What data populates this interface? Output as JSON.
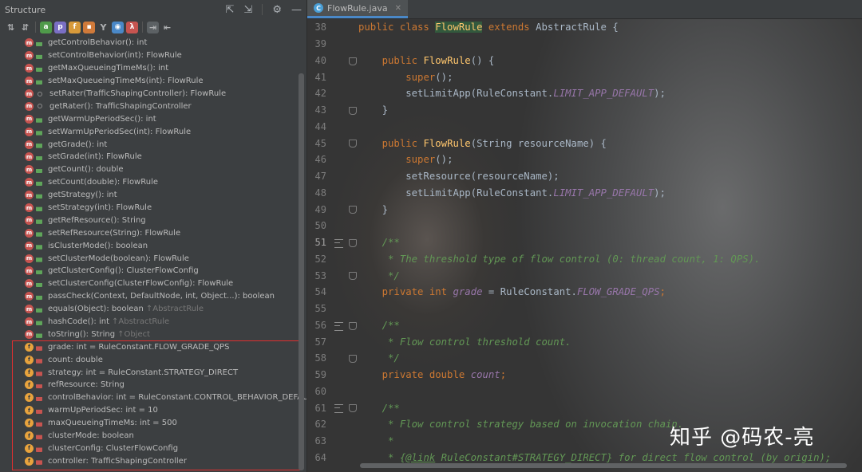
{
  "structure": {
    "title": "Structure",
    "toolbar_icons": [
      "sort-alpha-icon",
      "sort-visibility-icon",
      "show-anonymous-icon",
      "show-properties-icon",
      "show-fields-icon",
      "show-nonpublic-icon",
      "show-inherited-icon",
      "show-lambdas-icon",
      "show-toplevel-icon",
      "autoscroll-to-source-icon",
      "autoscroll-from-source-icon"
    ],
    "items": [
      {
        "kind": "m",
        "vis": "pub",
        "text": "getControlBehavior(): int"
      },
      {
        "kind": "m",
        "vis": "pub",
        "text": "setControlBehavior(int): FlowRule"
      },
      {
        "kind": "m",
        "vis": "pub",
        "text": "getMaxQueueingTimeMs(): int"
      },
      {
        "kind": "m",
        "vis": "pub",
        "text": "setMaxQueueingTimeMs(int): FlowRule"
      },
      {
        "kind": "m",
        "vis": "pkg",
        "text": "setRater(TrafficShapingController): FlowRule"
      },
      {
        "kind": "m",
        "vis": "pkg",
        "text": "getRater(): TrafficShapingController"
      },
      {
        "kind": "m",
        "vis": "pub",
        "text": "getWarmUpPeriodSec(): int"
      },
      {
        "kind": "m",
        "vis": "pub",
        "text": "setWarmUpPeriodSec(int): FlowRule"
      },
      {
        "kind": "m",
        "vis": "pub",
        "text": "getGrade(): int"
      },
      {
        "kind": "m",
        "vis": "pub",
        "text": "setGrade(int): FlowRule"
      },
      {
        "kind": "m",
        "vis": "pub",
        "text": "getCount(): double"
      },
      {
        "kind": "m",
        "vis": "pub",
        "text": "setCount(double): FlowRule"
      },
      {
        "kind": "m",
        "vis": "pub",
        "text": "getStrategy(): int"
      },
      {
        "kind": "m",
        "vis": "pub",
        "text": "setStrategy(int): FlowRule"
      },
      {
        "kind": "m",
        "vis": "pub",
        "text": "getRefResource(): String"
      },
      {
        "kind": "m",
        "vis": "pub",
        "text": "setRefResource(String): FlowRule"
      },
      {
        "kind": "m",
        "vis": "pub",
        "text": "isClusterMode(): boolean"
      },
      {
        "kind": "m",
        "vis": "pub",
        "text": "setClusterMode(boolean): FlowRule"
      },
      {
        "kind": "m",
        "vis": "pub",
        "text": "getClusterConfig(): ClusterFlowConfig"
      },
      {
        "kind": "m",
        "vis": "pub",
        "text": "setClusterConfig(ClusterFlowConfig): FlowRule"
      },
      {
        "kind": "m",
        "vis": "pub",
        "text": "passCheck(Context, DefaultNode, int, Object...): boolean"
      },
      {
        "kind": "m",
        "vis": "pub",
        "text": "equals(Object): boolean",
        "inherited": "↑AbstractRule"
      },
      {
        "kind": "m",
        "vis": "pub",
        "text": "hashCode(): int",
        "inherited": "↑AbstractRule"
      },
      {
        "kind": "m",
        "vis": "pub",
        "text": "toString(): String",
        "inherited": "↑Object"
      },
      {
        "kind": "f",
        "vis": "priv",
        "text": "grade: int = RuleConstant.FLOW_GRADE_QPS"
      },
      {
        "kind": "f",
        "vis": "priv",
        "text": "count: double"
      },
      {
        "kind": "f",
        "vis": "priv",
        "text": "strategy: int = RuleConstant.STRATEGY_DIRECT"
      },
      {
        "kind": "f",
        "vis": "priv",
        "text": "refResource: String"
      },
      {
        "kind": "f",
        "vis": "priv",
        "text": "controlBehavior: int = RuleConstant.CONTROL_BEHAVIOR_DEFAULT"
      },
      {
        "kind": "f",
        "vis": "priv",
        "text": "warmUpPeriodSec: int = 10"
      },
      {
        "kind": "f",
        "vis": "priv",
        "text": "maxQueueingTimeMs: int = 500"
      },
      {
        "kind": "f",
        "vis": "priv",
        "text": "clusterMode: boolean"
      },
      {
        "kind": "f",
        "vis": "priv",
        "text": "clusterConfig: ClusterFlowConfig"
      },
      {
        "kind": "f",
        "vis": "priv",
        "text": "controller: TrafficShapingController"
      }
    ]
  },
  "editor": {
    "tab_label": "FlowRule.java",
    "current_line": "51",
    "lines": [
      {
        "n": "38",
        "fold": false,
        "bm": false,
        "tokens": [
          [
            "kw",
            "public class "
          ],
          [
            "hl",
            "FlowRule"
          ],
          [
            "kw",
            " extends "
          ],
          [
            "txt",
            "AbstractRule {"
          ]
        ]
      },
      {
        "n": "39",
        "tokens": []
      },
      {
        "n": "40",
        "fold": true,
        "tokens": [
          [
            "txt",
            "    "
          ],
          [
            "kw",
            "public "
          ],
          [
            "fn",
            "FlowRule"
          ],
          [
            "txt",
            "() {"
          ]
        ]
      },
      {
        "n": "41",
        "tokens": [
          [
            "txt",
            "        "
          ],
          [
            "kw",
            "super"
          ],
          [
            "txt",
            "();"
          ]
        ]
      },
      {
        "n": "42",
        "tokens": [
          [
            "txt",
            "        setLimitApp(RuleConstant."
          ],
          [
            "cst",
            "LIMIT_APP_DEFAULT"
          ],
          [
            "txt",
            ");"
          ]
        ]
      },
      {
        "n": "43",
        "fold": true,
        "tokens": [
          [
            "txt",
            "    }"
          ]
        ]
      },
      {
        "n": "44",
        "tokens": []
      },
      {
        "n": "45",
        "fold": true,
        "tokens": [
          [
            "txt",
            "    "
          ],
          [
            "kw",
            "public "
          ],
          [
            "fn",
            "FlowRule"
          ],
          [
            "txt",
            "(String resourceName) {"
          ]
        ]
      },
      {
        "n": "46",
        "tokens": [
          [
            "txt",
            "        "
          ],
          [
            "kw",
            "super"
          ],
          [
            "txt",
            "();"
          ]
        ]
      },
      {
        "n": "47",
        "tokens": [
          [
            "txt",
            "        setResource(resourceName);"
          ]
        ]
      },
      {
        "n": "48",
        "tokens": [
          [
            "txt",
            "        setLimitApp(RuleConstant."
          ],
          [
            "cst",
            "LIMIT_APP_DEFAULT"
          ],
          [
            "txt",
            ");"
          ]
        ]
      },
      {
        "n": "49",
        "fold": true,
        "tokens": [
          [
            "txt",
            "    }"
          ]
        ]
      },
      {
        "n": "50",
        "tokens": []
      },
      {
        "n": "51",
        "fold": true,
        "bm": true,
        "tokens": [
          [
            "txt",
            "    "
          ],
          [
            "cm",
            "/**"
          ]
        ]
      },
      {
        "n": "52",
        "tokens": [
          [
            "cm",
            "     * The threshold type of flow control (0: thread count, 1: QPS)."
          ]
        ]
      },
      {
        "n": "53",
        "fold": true,
        "tokens": [
          [
            "cm",
            "     */"
          ]
        ]
      },
      {
        "n": "54",
        "tokens": [
          [
            "txt",
            "    "
          ],
          [
            "kw",
            "private int "
          ],
          [
            "cst",
            "grade"
          ],
          [
            "txt",
            " = RuleConstant."
          ],
          [
            "cst",
            "FLOW_GRADE_QPS"
          ],
          [
            "kw",
            ";"
          ]
        ]
      },
      {
        "n": "55",
        "tokens": []
      },
      {
        "n": "56",
        "fold": true,
        "bm": true,
        "tokens": [
          [
            "txt",
            "    "
          ],
          [
            "cm",
            "/**"
          ]
        ]
      },
      {
        "n": "57",
        "tokens": [
          [
            "cm",
            "     * Flow control threshold count."
          ]
        ]
      },
      {
        "n": "58",
        "fold": true,
        "tokens": [
          [
            "cm",
            "     */"
          ]
        ]
      },
      {
        "n": "59",
        "tokens": [
          [
            "txt",
            "    "
          ],
          [
            "kw",
            "private double "
          ],
          [
            "cst",
            "count"
          ],
          [
            "kw",
            ";"
          ]
        ]
      },
      {
        "n": "60",
        "tokens": []
      },
      {
        "n": "61",
        "fold": true,
        "bm": true,
        "tokens": [
          [
            "txt",
            "    "
          ],
          [
            "cm",
            "/**"
          ]
        ]
      },
      {
        "n": "62",
        "tokens": [
          [
            "cm",
            "     * Flow control strategy based on invocation chain."
          ]
        ]
      },
      {
        "n": "63",
        "tokens": [
          [
            "cm",
            "     *"
          ]
        ]
      },
      {
        "n": "64",
        "tokens": [
          [
            "cm",
            "     * {"
          ],
          [
            "cmtag",
            "@link"
          ],
          [
            "cm",
            " RuleConstant#STRATEGY_DIRECT} for direct flow control (by origin);"
          ]
        ]
      }
    ]
  },
  "watermark": "知乎 @码农-亮"
}
